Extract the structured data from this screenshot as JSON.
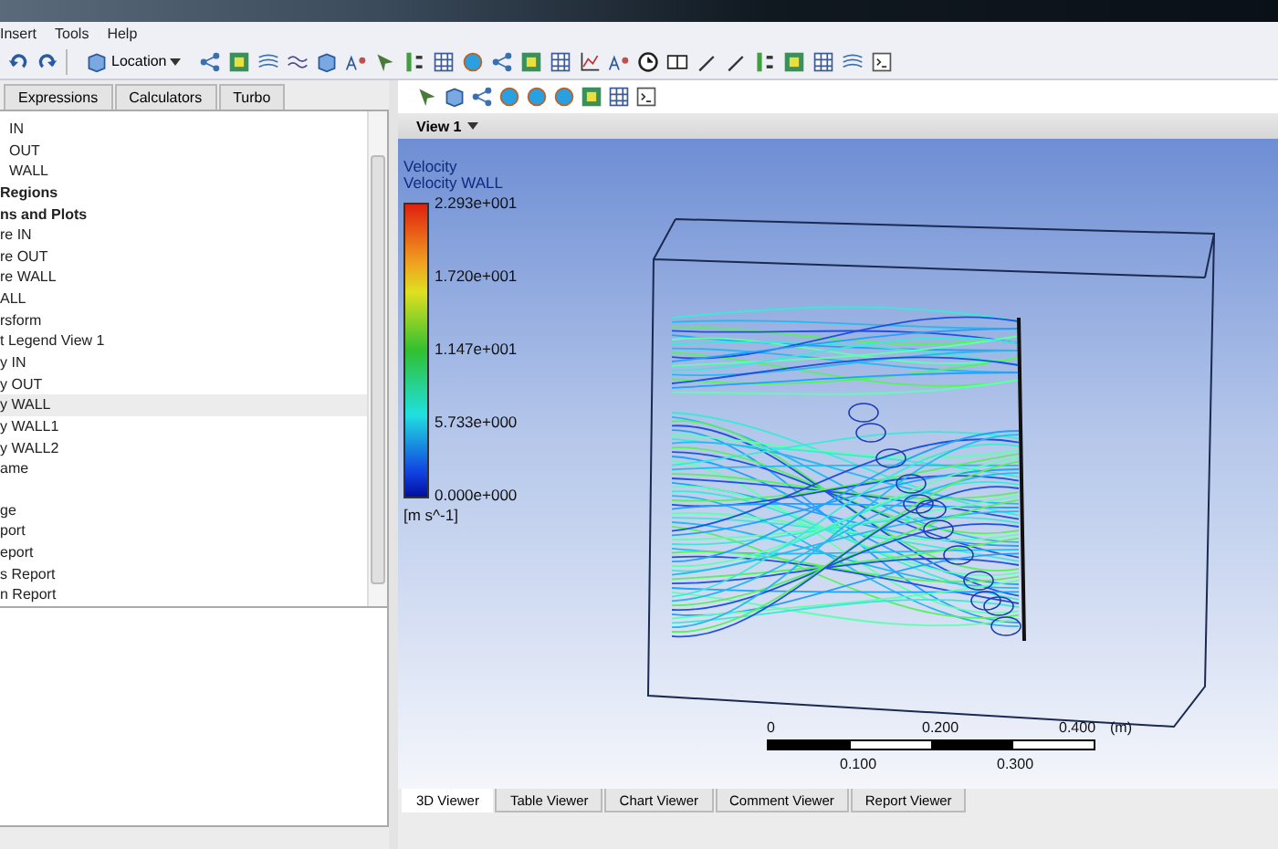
{
  "menu": [
    {
      "label": "Insert"
    },
    {
      "label": "Tools"
    },
    {
      "label": "Help"
    }
  ],
  "toolbar": {
    "location_button": "Location"
  },
  "panel_tabs": [
    {
      "label": "Expressions",
      "selected": false
    },
    {
      "label": "Calculators",
      "selected": false
    },
    {
      "label": "Turbo",
      "selected": false
    }
  ],
  "tree": [
    {
      "kind": "item",
      "label": "IN",
      "selected": false
    },
    {
      "kind": "item",
      "label": "OUT",
      "selected": false
    },
    {
      "kind": "item",
      "label": "WALL",
      "selected": false
    },
    {
      "kind": "header",
      "label": "Regions",
      "selected": false
    },
    {
      "kind": "header",
      "label": "ns and Plots",
      "selected": false
    },
    {
      "kind": "item",
      "label": "re IN",
      "selected": false
    },
    {
      "kind": "item",
      "label": "re OUT",
      "selected": false
    },
    {
      "kind": "item",
      "label": "re WALL",
      "selected": false
    },
    {
      "kind": "item",
      "label": "ALL",
      "selected": false
    },
    {
      "kind": "item",
      "label": "rsform",
      "selected": false
    },
    {
      "kind": "item",
      "label": "t Legend View 1",
      "selected": false
    },
    {
      "kind": "item",
      "label": "y IN",
      "selected": false
    },
    {
      "kind": "item",
      "label": "y OUT",
      "selected": false
    },
    {
      "kind": "item",
      "label": "y WALL",
      "selected": true
    },
    {
      "kind": "item",
      "label": "y WALL1",
      "selected": false
    },
    {
      "kind": "item",
      "label": "y WALL2",
      "selected": false
    },
    {
      "kind": "item",
      "label": "ame",
      "selected": false
    },
    {
      "kind": "spacer"
    },
    {
      "kind": "item",
      "label": "ge",
      "selected": false
    },
    {
      "kind": "item",
      "label": "port",
      "selected": false
    },
    {
      "kind": "item",
      "label": "eport",
      "selected": false
    },
    {
      "kind": "item",
      "label": "s Report",
      "selected": false
    },
    {
      "kind": "item",
      "label": "n Report",
      "selected": false
    }
  ],
  "viewer": {
    "view_menu": "View 1",
    "legend": {
      "title": "Velocity",
      "subtitle": "Velocity WALL",
      "labels": [
        "2.293e+001",
        "1.720e+001",
        "1.147e+001",
        "5.733e+000",
        "0.000e+000"
      ],
      "unit": "[m s^-1]"
    },
    "scale_bar": {
      "top_labels": [
        "0",
        "0.200",
        "0.400"
      ],
      "unit": "(m)",
      "bottom_labels": [
        "0.100",
        "0.300"
      ]
    }
  },
  "viewer_tabs": [
    {
      "label": "3D Viewer",
      "selected": true
    },
    {
      "label": "Table Viewer",
      "selected": false
    },
    {
      "label": "Chart Viewer",
      "selected": false
    },
    {
      "label": "Comment Viewer",
      "selected": false
    },
    {
      "label": "Report Viewer",
      "selected": false
    }
  ]
}
